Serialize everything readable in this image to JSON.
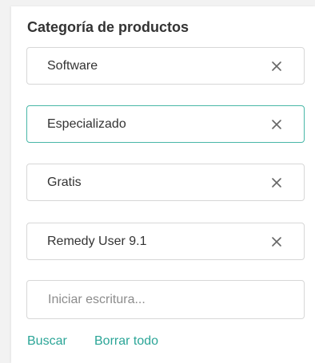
{
  "filter": {
    "title": "Categoría de productos",
    "chips": [
      {
        "label": "Software",
        "remove_icon": "close-icon",
        "focused": false
      },
      {
        "label": "Especializado",
        "remove_icon": "close-icon",
        "focused": true
      },
      {
        "label": "Gratis",
        "remove_icon": "close-icon",
        "focused": false
      },
      {
        "label": "Remedy User 9.1",
        "remove_icon": "close-icon",
        "focused": false
      }
    ],
    "input": {
      "value": "",
      "placeholder": "Iniciar escritura..."
    },
    "actions": {
      "search_label": "Buscar",
      "clear_all_label": "Borrar todo"
    }
  },
  "colors": {
    "accent": "#2ba597",
    "focus_border": "#48b7a7",
    "border": "#d7d7d7",
    "text": "#333333",
    "placeholder": "#8c8c8c",
    "background": "#f2f2f2"
  }
}
